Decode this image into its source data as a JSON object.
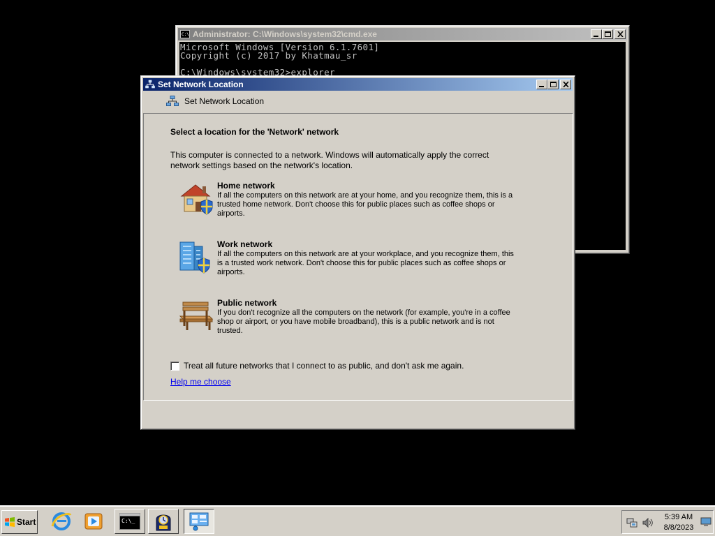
{
  "cmd_window": {
    "title": "Administrator: C:\\Windows\\system32\\cmd.exe",
    "lines": [
      "Microsoft Windows [Version 6.1.7601]",
      "Copyright (c) 2017 by Khatmau_sr",
      "",
      "C:\\Windows\\system32>explorer"
    ]
  },
  "dialog": {
    "title": "Set Network Location",
    "header": "Set Network Location",
    "heading": "Select a location for the 'Network' network",
    "intro": "This computer is connected to a network. Windows will automatically apply the correct network settings based on the network's location.",
    "options": [
      {
        "title": "Home network",
        "description": "If all the computers on this network are at your home, and you recognize them, this is a trusted home network.  Don't choose this for public places such as coffee shops or airports.",
        "icon": "home-network-icon"
      },
      {
        "title": "Work network",
        "description": "If all the computers on this network are at your workplace, and you recognize them, this is a trusted work network.  Don't choose this for public places such as coffee shops or airports.",
        "icon": "work-network-icon"
      },
      {
        "title": "Public network",
        "description": "If you don't recognize all the computers on the network (for example, you're in a coffee shop or airport, or you have mobile broadband), this is a public network and is not trusted.",
        "icon": "public-network-icon"
      }
    ],
    "checkbox_label": "Treat all future networks that I connect to as public, and don't ask me again.",
    "checkbox_checked": false,
    "help_link": "Help me choose"
  },
  "taskbar": {
    "start_label": "Start",
    "pinned": [
      "internet-explorer-icon",
      "media-player-icon"
    ],
    "running": [
      "command-prompt-icon",
      "system-tool-icon",
      "network-settings-icon"
    ],
    "clock": {
      "time": "5:39 AM",
      "date": "8/8/2023"
    },
    "tray_icons": [
      "network-tray-icon",
      "volume-icon",
      "show-desktop-icon"
    ]
  },
  "colors": {
    "active_title_start": "#0a246a",
    "active_title_end": "#a6caf0",
    "inactive_title": "#808080",
    "face": "#d4d0c8",
    "link": "#0000ee"
  }
}
